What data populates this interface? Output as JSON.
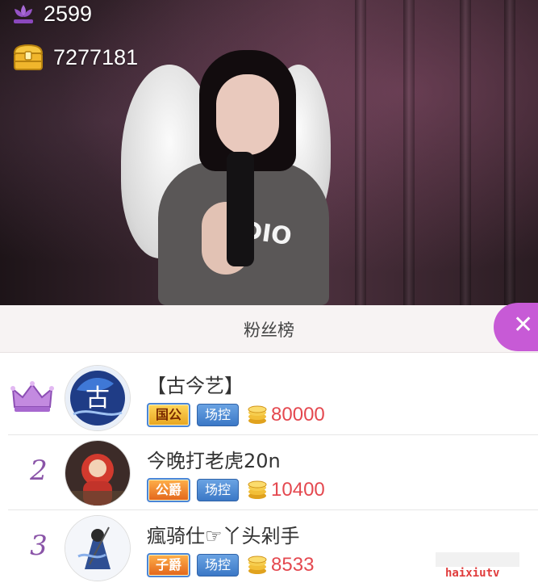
{
  "stream": {
    "flower_count": "2599",
    "treasure_count": "7277181",
    "shirt_logo_text": "DIO"
  },
  "fans_panel": {
    "title": "粉丝榜",
    "close_icon": "close-icon",
    "accent_color": "#c75ad6",
    "rows": [
      {
        "rank": "",
        "rank_icon": "crown-icon",
        "name": "【古今艺】",
        "title_badge": "国公",
        "control_badge": "场控",
        "coins": "80000"
      },
      {
        "rank": "2",
        "name": "今晚打老虎20n",
        "title_badge": "公爵",
        "control_badge": "场控",
        "coins": "10400"
      },
      {
        "rank": "3",
        "name": "瘋骑仕☞丫头剁手",
        "title_badge": "子爵",
        "control_badge": "场控",
        "coins": "8533"
      }
    ]
  },
  "watermark": "haixiutv"
}
